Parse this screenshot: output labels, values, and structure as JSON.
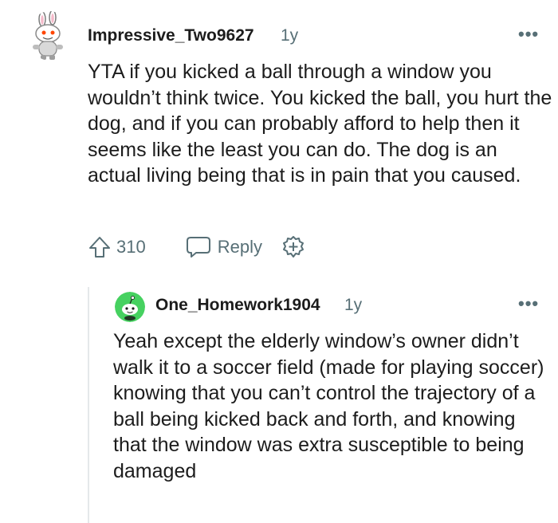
{
  "comment1": {
    "username": "Impressive_Two9627",
    "time": "1y",
    "more": "•••",
    "body": "YTA if you kicked a ball through a window you wouldn’t think twice. You kicked the ball, you hurt the dog, and if you can probably afford to help then it seems like the least you can do. The dog is an actual living being that is in pain that you caused.",
    "votes": "310",
    "reply_label": "Reply",
    "icons": {
      "avatar": "snoo-bunny-avatar-icon",
      "upvote": "upvote-arrow-icon",
      "reply": "chat-bubble-icon",
      "award": "add-award-icon"
    }
  },
  "comment2": {
    "username": "One_Homework1904",
    "time": "1y",
    "more": "•••",
    "body": "Yeah except the elderly window’s owner didn’t walk it to a soccer field (made for playing soccer) knowing that you can’t control the trajectory of a ball being kicked back and forth, and knowing that the window was extra susceptible to being damaged",
    "icons": {
      "avatar": "snoo-green-avatar-icon"
    }
  },
  "colors": {
    "text": "#1c1c1c",
    "meta": "#576f76",
    "thread_line": "#e5e8ea",
    "avatar2_bg": "#46d160"
  }
}
